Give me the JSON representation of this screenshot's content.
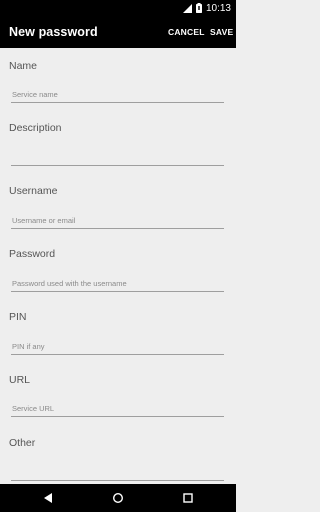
{
  "status_bar": {
    "time": "10:13",
    "icons": [
      "signal-icon",
      "battery-icon"
    ]
  },
  "app_bar": {
    "title": "New password",
    "cancel_label": "CANCEL",
    "save_label": "SAVE"
  },
  "form": {
    "fields": [
      {
        "label": "Name",
        "placeholder": "Service name",
        "value": ""
      },
      {
        "label": "Description",
        "placeholder": "",
        "value": ""
      },
      {
        "label": "Username",
        "placeholder": "Username or email",
        "value": ""
      },
      {
        "label": "Password",
        "placeholder": "Password used with the username",
        "value": ""
      },
      {
        "label": "PIN",
        "placeholder": "PIN if any",
        "value": ""
      },
      {
        "label": "URL",
        "placeholder": "Service URL",
        "value": ""
      },
      {
        "label": "Other",
        "placeholder": "",
        "value": ""
      }
    ]
  },
  "nav_bar": {
    "icons": [
      "back-icon",
      "home-icon",
      "recents-icon"
    ]
  },
  "colors": {
    "bar_background": "#000000",
    "page_background": "#eeeeee",
    "label_text": "#555555",
    "underline": "#9e9e9e"
  }
}
